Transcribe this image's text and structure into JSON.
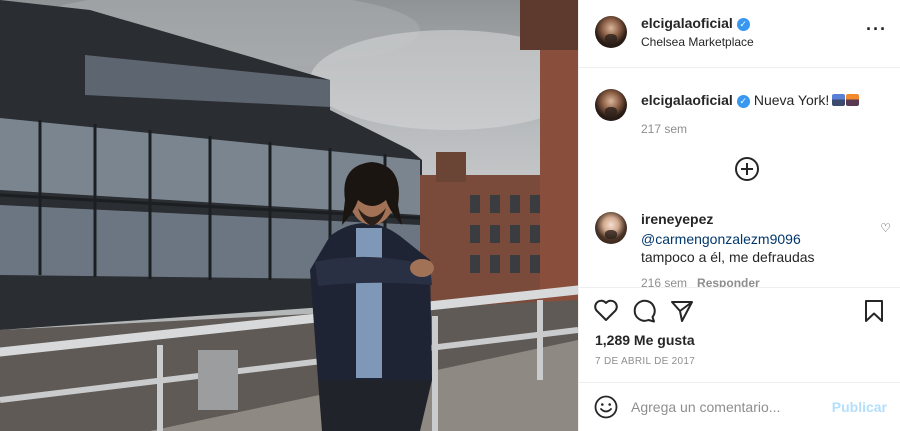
{
  "post": {
    "author": {
      "username": "elcigalaoficial",
      "verified": true,
      "location": "Chelsea Marketplace"
    },
    "caption": {
      "username": "elcigalaoficial",
      "text": "Nueva York!",
      "emojis": [
        "night-city-emoji",
        "sunset-city-emoji"
      ],
      "time": "217 sem"
    },
    "load_more_icon": "plus-circle-icon",
    "comments": [
      {
        "username": "ireneyepez",
        "mention": "@carmengonzalezm9096",
        "text": "tampoco a él, me defraudas",
        "time": "216 sem",
        "reply_label": "Responder",
        "like_icon": "heart-outline-icon"
      }
    ],
    "actions": {
      "icons": [
        "heart-icon",
        "comment-icon",
        "share-icon",
        "bookmark-icon"
      ],
      "likes": "1,289 Me gusta",
      "date": "7 DE ABRIL DE 2017"
    },
    "add_comment": {
      "emoji_icon": "smiley-icon",
      "placeholder": "Agrega un comentario...",
      "post_label": "Publicar"
    },
    "colors": {
      "link": "#00376b",
      "verified": "#3897f0",
      "publish_disabled": "#b2dffc",
      "muted": "#8e8e8e"
    }
  }
}
